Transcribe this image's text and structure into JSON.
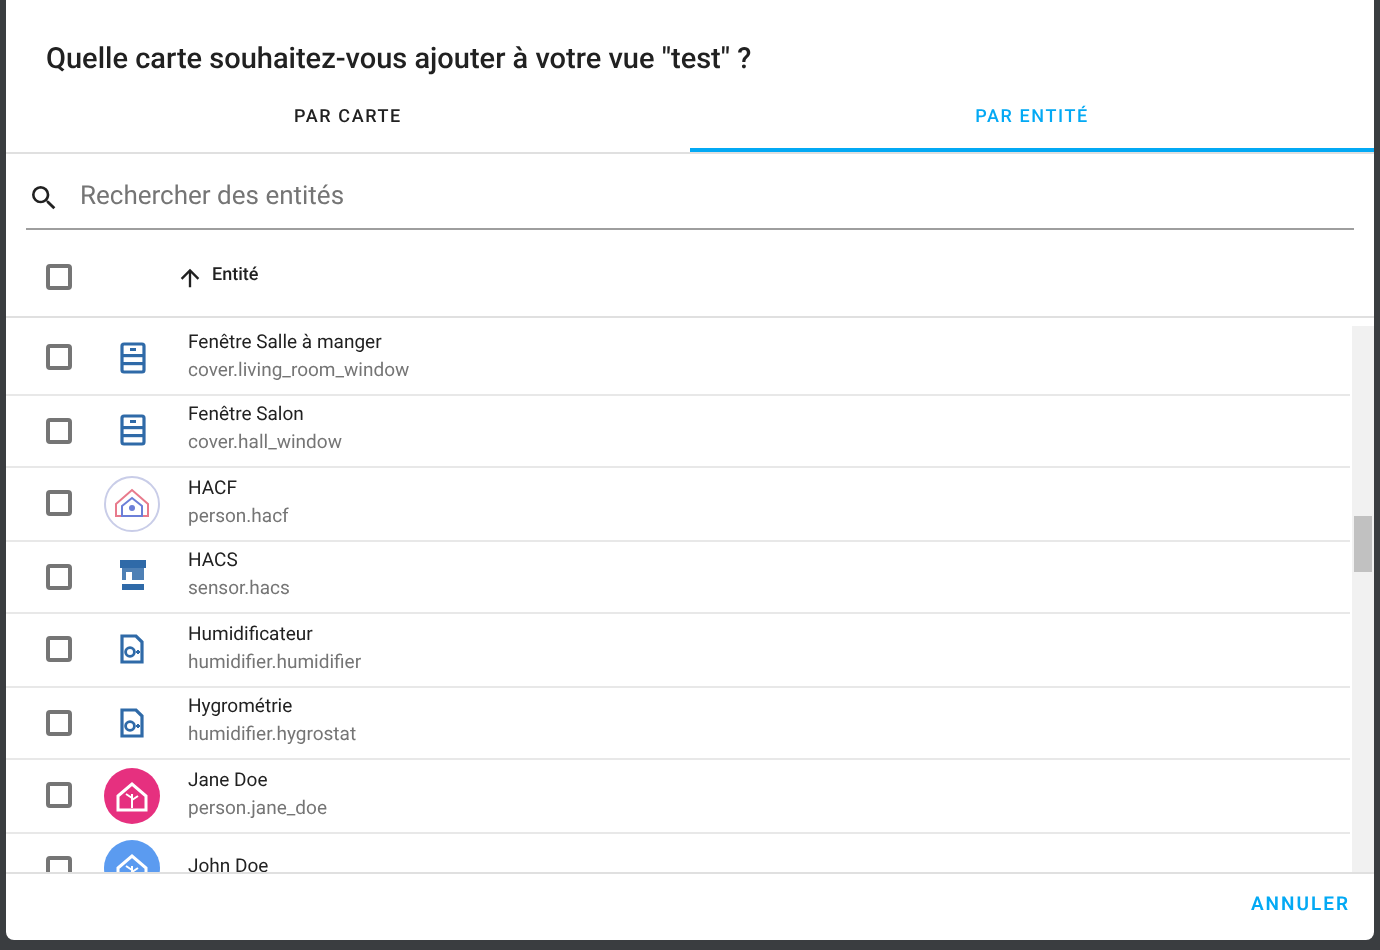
{
  "dialog": {
    "title": "Quelle carte souhaitez-vous ajouter à votre vue \"test\" ?"
  },
  "tabs": [
    {
      "label": "PAR CARTE",
      "selected": false
    },
    {
      "label": "PAR ENTITÉ",
      "selected": true
    }
  ],
  "search": {
    "placeholder": "Rechercher des entités"
  },
  "table": {
    "select_all_checked": false,
    "column": "Entité",
    "rows": [
      {
        "name": "Fenêtre Salle à manger",
        "entity_id": "cover.living_room_window",
        "kind": "cover",
        "checked": false
      },
      {
        "name": "Fenêtre Salon",
        "entity_id": "cover.hall_window",
        "kind": "cover",
        "checked": false
      },
      {
        "name": "HACF",
        "entity_id": "person.hacf",
        "kind": "logo",
        "checked": false
      },
      {
        "name": "HACS",
        "entity_id": "sensor.hacs",
        "kind": "hacs",
        "checked": false
      },
      {
        "name": "Humidificateur",
        "entity_id": "humidifier.humidifier",
        "kind": "humidifier",
        "checked": false
      },
      {
        "name": "Hygrométrie",
        "entity_id": "humidifier.hygrostat",
        "kind": "humidifier",
        "checked": false
      },
      {
        "name": "Jane Doe",
        "entity_id": "person.jane_doe",
        "kind": "avatar",
        "color": "#e6307f",
        "checked": false
      },
      {
        "name": "John Doe",
        "kind": "avatar",
        "color": "#5b9bf0",
        "checked": false
      }
    ]
  },
  "buttons": [
    {
      "label": "ANNULER"
    }
  ]
}
